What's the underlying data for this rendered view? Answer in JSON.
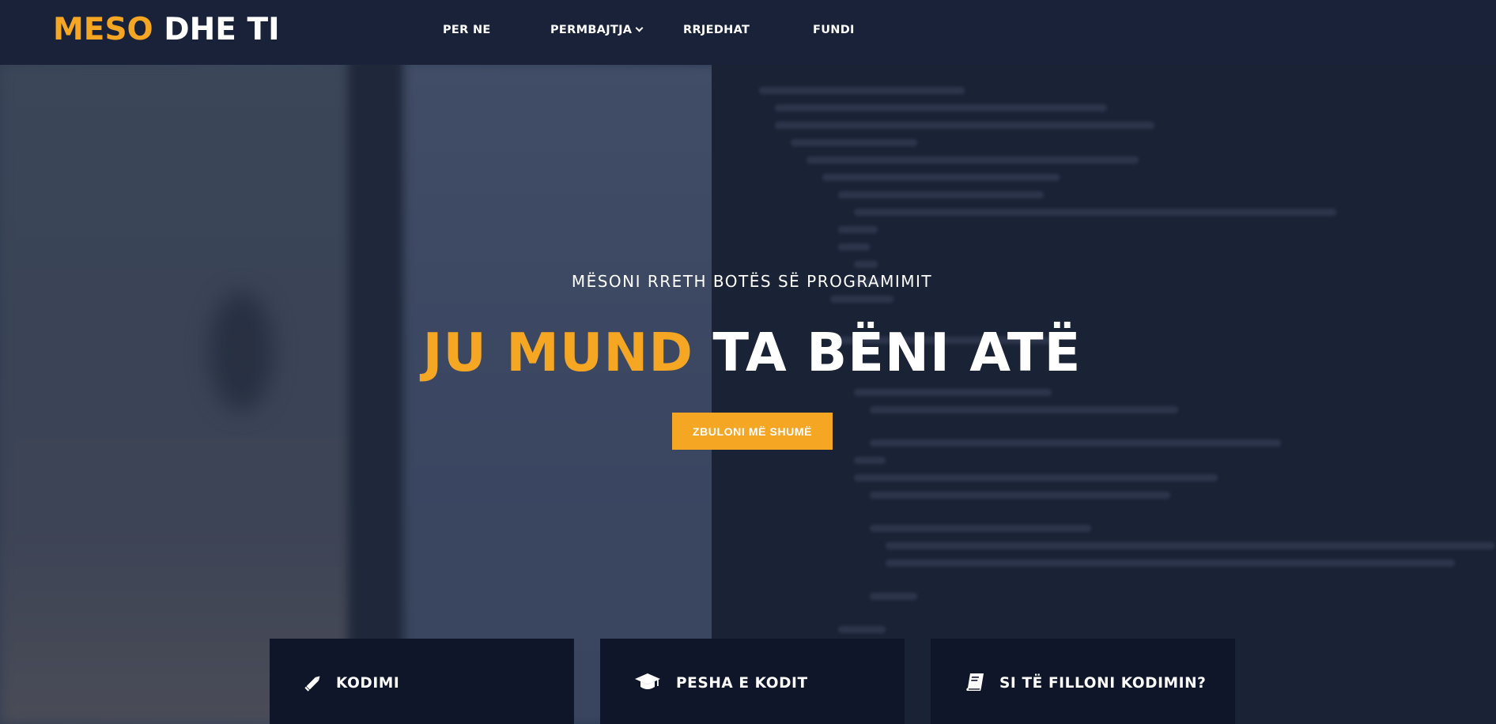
{
  "nav": {
    "logo_accent": "MESO",
    "logo_rest": "DHE TI",
    "items": [
      {
        "label": "PER NE"
      },
      {
        "label": "PERMBAJTJA"
      },
      {
        "label": "RRJEDHAT"
      },
      {
        "label": "FUNDI"
      }
    ],
    "dropdown_icon": "chevron-down-icon"
  },
  "hero": {
    "subtitle": "MËSONI RRETH BOTËS SË PROGRAMIMIT",
    "headline_accent": "JU MUND",
    "headline_rest": "TA BËNI ATË",
    "cta_label": "ZBULONI MË SHUMË"
  },
  "cards": [
    {
      "title": "KODIMI",
      "icon": "pencil-icon"
    },
    {
      "title": "PESHA E KODIT",
      "icon": "graduation-cap-icon"
    },
    {
      "title": "SI TË FILLONI KODIMIN?",
      "icon": "book-icon"
    }
  ],
  "colors": {
    "accent": "#f5a623",
    "navbar": "#192239",
    "card_bg": "#0f1629",
    "text": "#ffffff"
  }
}
